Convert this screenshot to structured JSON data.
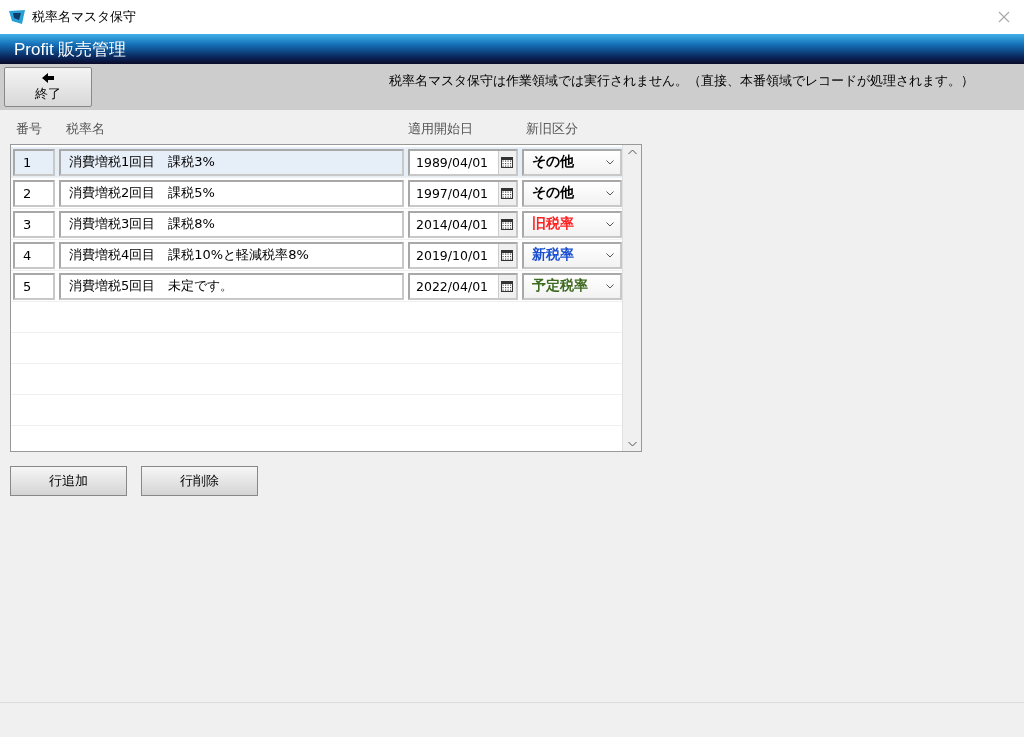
{
  "window": {
    "title": "税率名マスタ保守"
  },
  "header": {
    "title": "Profit 販売管理"
  },
  "toolbar": {
    "exit_button": "終了",
    "notice": "税率名マスタ保守は作業領域では実行されません。（直接、本番領域でレコードが処理されます。）"
  },
  "table": {
    "columns": [
      "番号",
      "税率名",
      "適用開始日",
      "新旧区分"
    ],
    "rows": [
      {
        "number": "1",
        "name": "消費増税1回目　課税3%",
        "start_date": "1989/04/01",
        "category": "その他",
        "color": "#000000",
        "selected": true
      },
      {
        "number": "2",
        "name": "消費増税2回目　課税5%",
        "start_date": "1997/04/01",
        "category": "その他",
        "color": "#000000",
        "selected": false
      },
      {
        "number": "3",
        "name": "消費増税3回目　課税8%",
        "start_date": "2014/04/01",
        "category": "旧税率",
        "color": "#ff2020",
        "selected": false
      },
      {
        "number": "4",
        "name": "消費増税4回目　課税10%と軽減税率8%",
        "start_date": "2019/10/01",
        "category": "新税率",
        "color": "#1a4fd0",
        "selected": false
      },
      {
        "number": "5",
        "name": "消費増税5回目　未定です。",
        "start_date": "2022/04/01",
        "category": "予定税率",
        "color": "#3d6b1f",
        "selected": false
      }
    ]
  },
  "buttons": [
    "行追加",
    "行削除"
  ]
}
